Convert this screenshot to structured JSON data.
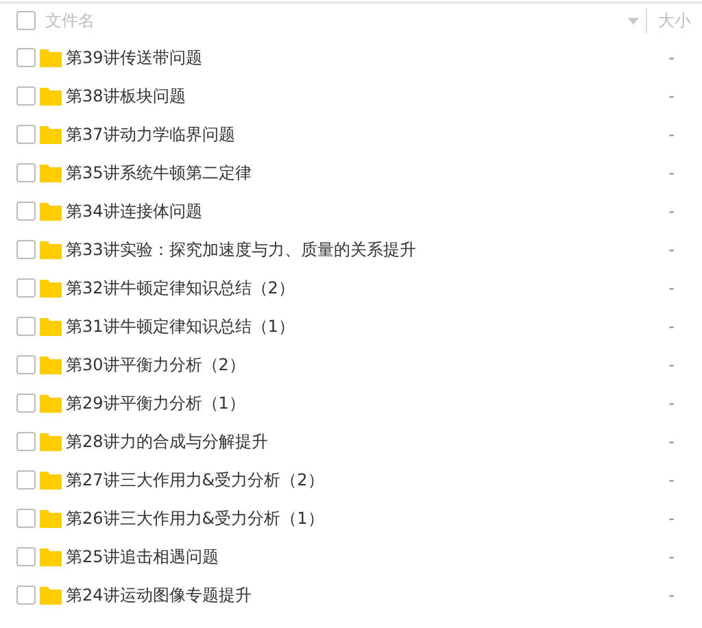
{
  "header": {
    "checked": false,
    "name_column": "文件名",
    "size_column": "大小"
  },
  "files": [
    {
      "name": "第39讲传送带问题",
      "size": "-",
      "checked": false
    },
    {
      "name": "第38讲板块问题",
      "size": "-",
      "checked": false
    },
    {
      "name": "第37讲动力学临界问题",
      "size": "-",
      "checked": false
    },
    {
      "name": "第35讲系统牛顿第二定律",
      "size": "-",
      "checked": false
    },
    {
      "name": "第34讲连接体问题",
      "size": "-",
      "checked": false
    },
    {
      "name": "第33讲实验：探究加速度与力、质量的关系提升",
      "size": "-",
      "checked": false
    },
    {
      "name": "第32讲牛顿定律知识总结（2）",
      "size": "-",
      "checked": false
    },
    {
      "name": "第31讲牛顿定律知识总结（1）",
      "size": "-",
      "checked": false
    },
    {
      "name": "第30讲平衡力分析（2）",
      "size": "-",
      "checked": false
    },
    {
      "name": "第29讲平衡力分析（1）",
      "size": "-",
      "checked": false
    },
    {
      "name": "第28讲力的合成与分解提升",
      "size": "-",
      "checked": false
    },
    {
      "name": "第27讲三大作用力&受力分析（2）",
      "size": "-",
      "checked": false
    },
    {
      "name": "第26讲三大作用力&受力分析（1）",
      "size": "-",
      "checked": false
    },
    {
      "name": "第25讲追击相遇问题",
      "size": "-",
      "checked": false
    },
    {
      "name": "第24讲运动图像专题提升",
      "size": "-",
      "checked": false
    }
  ]
}
